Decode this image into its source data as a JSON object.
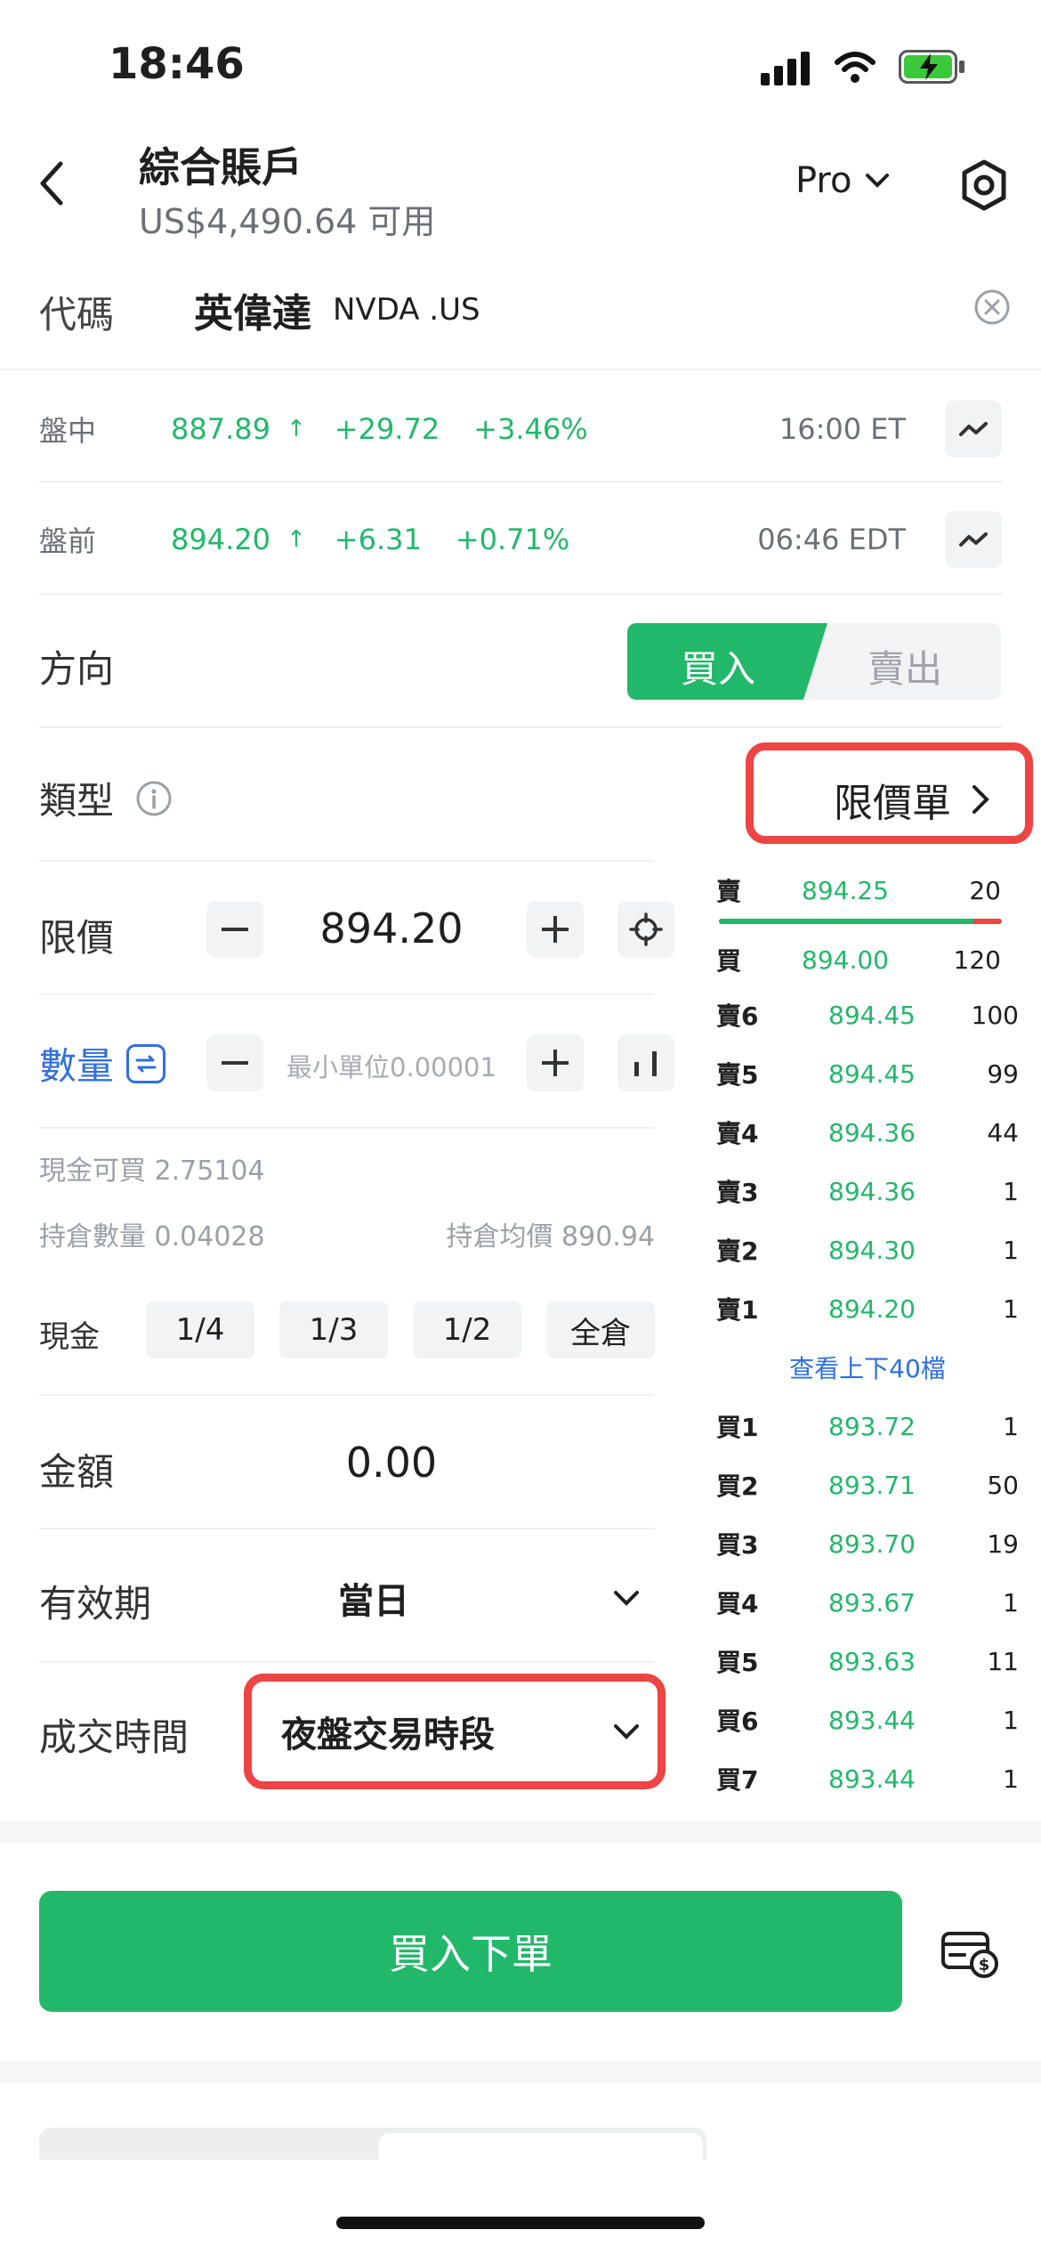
{
  "status_bar": {
    "time": "18:46"
  },
  "header": {
    "title": "綜合賬戶",
    "subtitle": "US$4,490.64 可用",
    "mode": "Pro"
  },
  "symbol": {
    "label": "代碼",
    "name": "英偉達",
    "ticker": "NVDA .US"
  },
  "quotes": [
    {
      "session": "盤中",
      "price": "887.89",
      "arrow": "↑",
      "change": "+29.72",
      "pct": "+3.46%",
      "time": "16:00 ET"
    },
    {
      "session": "盤前",
      "price": "894.20",
      "arrow": "↑",
      "change": "+6.31",
      "pct": "+0.71%",
      "time": "06:46 EDT"
    }
  ],
  "direction": {
    "label": "方向",
    "buy": "買入",
    "sell": "賣出"
  },
  "order_type": {
    "label": "類型",
    "value": "限價單"
  },
  "limit": {
    "label": "限價",
    "value": "894.20"
  },
  "quantity": {
    "label": "數量",
    "placeholder": "最小單位0.00001"
  },
  "info": {
    "cash_buy": "現金可買 2.75104",
    "position_qty": "持倉數量 0.04028",
    "position_avg": "持倉均價 890.94"
  },
  "fraction": {
    "label": "現金",
    "options": [
      "1/4",
      "1/3",
      "1/2",
      "全倉"
    ]
  },
  "amount": {
    "label": "金額",
    "value": "0.00"
  },
  "validity": {
    "label": "有效期",
    "value": "當日"
  },
  "session_time": {
    "label": "成交時間",
    "value": "夜盤交易時段"
  },
  "orderbook": {
    "top": [
      {
        "label": "賣",
        "price": "894.25",
        "qty": "20"
      },
      {
        "label": "買",
        "price": "894.00",
        "qty": "120"
      }
    ],
    "bid_ratio": 0.9,
    "asks": [
      {
        "label": "賣6",
        "price": "894.45",
        "qty": "100"
      },
      {
        "label": "賣5",
        "price": "894.45",
        "qty": "99"
      },
      {
        "label": "賣4",
        "price": "894.36",
        "qty": "44"
      },
      {
        "label": "賣3",
        "price": "894.36",
        "qty": "1"
      },
      {
        "label": "賣2",
        "price": "894.30",
        "qty": "1"
      },
      {
        "label": "賣1",
        "price": "894.20",
        "qty": "1"
      }
    ],
    "more_link": "查看上下40檔",
    "bids": [
      {
        "label": "買1",
        "price": "893.72",
        "qty": "1"
      },
      {
        "label": "買2",
        "price": "893.71",
        "qty": "50"
      },
      {
        "label": "買3",
        "price": "893.70",
        "qty": "19"
      },
      {
        "label": "買4",
        "price": "893.67",
        "qty": "1"
      },
      {
        "label": "買5",
        "price": "893.63",
        "qty": "11"
      },
      {
        "label": "買6",
        "price": "893.44",
        "qty": "1"
      },
      {
        "label": "買7",
        "price": "893.44",
        "qty": "1"
      }
    ]
  },
  "submit": {
    "label": "買入下單"
  },
  "colors": {
    "accent": "#22b86a",
    "highlight": "#ee4444",
    "link": "#2f6fe0"
  }
}
